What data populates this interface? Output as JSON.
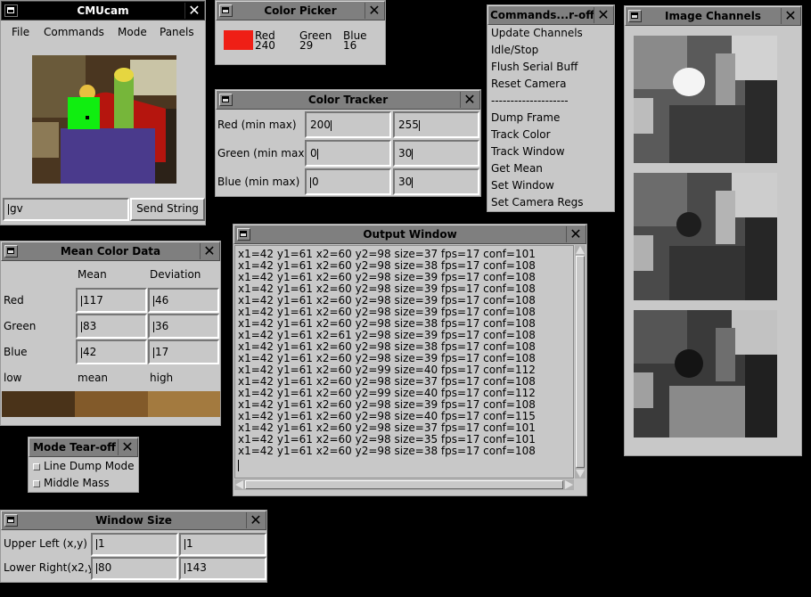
{
  "cmucam": {
    "title": "CMUcam",
    "menu": [
      "File",
      "Commands",
      "Mode",
      "Panels"
    ],
    "command_value": "gv",
    "send_label": "Send String"
  },
  "color_picker": {
    "title": "Color Picker",
    "swatch_color": "#ef1f16",
    "red_label": "Red",
    "red_value": "240",
    "green_label": "Green",
    "green_value": "29",
    "blue_label": "Blue",
    "blue_value": "16"
  },
  "color_tracker": {
    "title": "Color Tracker",
    "rows": [
      {
        "label": "Red (min max)",
        "min": "200",
        "max": "255"
      },
      {
        "label": "Green (min max",
        "min": "0",
        "max": "30"
      },
      {
        "label": "Blue (min max)",
        "min": "0",
        "max": "30"
      }
    ]
  },
  "commands": {
    "title": "Commands...r-off",
    "items": [
      "Update Channels",
      "Idle/Stop",
      "Flush Serial Buff",
      "Reset Camera",
      "--------------------",
      "Dump Frame",
      "Track Color",
      "Track Window",
      "Get Mean",
      "Set Window",
      "Set Camera Regs"
    ]
  },
  "image_channels": {
    "title": "Image Channels"
  },
  "mean_color": {
    "title": "Mean Color Data",
    "col_mean": "Mean",
    "col_dev": "Deviation",
    "rows": [
      {
        "label": "Red",
        "mean": "117",
        "dev": "46"
      },
      {
        "label": "Green",
        "mean": "83",
        "dev": "36"
      },
      {
        "label": "Blue",
        "mean": "42",
        "dev": "17"
      }
    ],
    "low": "low",
    "mean_lbl": "mean",
    "high": "high",
    "swatches": [
      "#4a3319",
      "#825a2a",
      "#a37a3f"
    ]
  },
  "output": {
    "title": "Output Window",
    "lines": [
      "x1=42 y1=61 x2=60 y2=98 size=37 fps=17 conf=101",
      "x1=42 y1=61 x2=60 y2=98 size=38 fps=17 conf=108",
      "x1=42 y1=61 x2=60 y2=98 size=39 fps=17 conf=108",
      "x1=42 y1=61 x2=60 y2=98 size=39 fps=17 conf=108",
      "x1=42 y1=61 x2=60 y2=98 size=39 fps=17 conf=108",
      "x1=42 y1=61 x2=60 y2=98 size=39 fps=17 conf=108",
      "x1=42 y1=61 x2=60 y2=98 size=38 fps=17 conf=108",
      "x1=42 y1=61 x2=61 y2=98 size=39 fps=17 conf=108",
      "x1=42 y1=61 x2=60 y2=98 size=38 fps=17 conf=108",
      "x1=42 y1=61 x2=60 y2=98 size=39 fps=17 conf=108",
      "x1=42 y1=61 x2=60 y2=99 size=40 fps=17 conf=112",
      "x1=42 y1=61 x2=60 y2=98 size=37 fps=17 conf=108",
      "x1=42 y1=61 x2=60 y2=99 size=40 fps=17 conf=112",
      "x1=42 y1=61 x2=60 y2=98 size=39 fps=17 conf=108",
      "x1=42 y1=61 x2=60 y2=98 size=40 fps=17 conf=115",
      "x1=42 y1=61 x2=60 y2=98 size=37 fps=17 conf=101",
      "x1=42 y1=61 x2=60 y2=98 size=35 fps=17 conf=101",
      "x1=42 y1=61 x2=60 y2=98 size=38 fps=17 conf=108"
    ]
  },
  "mode_tearoff": {
    "title": "Mode Tear-off",
    "items": [
      "Line Dump Mode",
      "Middle Mass"
    ]
  },
  "window_size": {
    "title": "Window Size",
    "rows": [
      {
        "label": "Upper Left (x,y)",
        "a": "1",
        "b": "1"
      },
      {
        "label": "Lower Right(x2,y",
        "a": "80",
        "b": "143"
      }
    ]
  }
}
